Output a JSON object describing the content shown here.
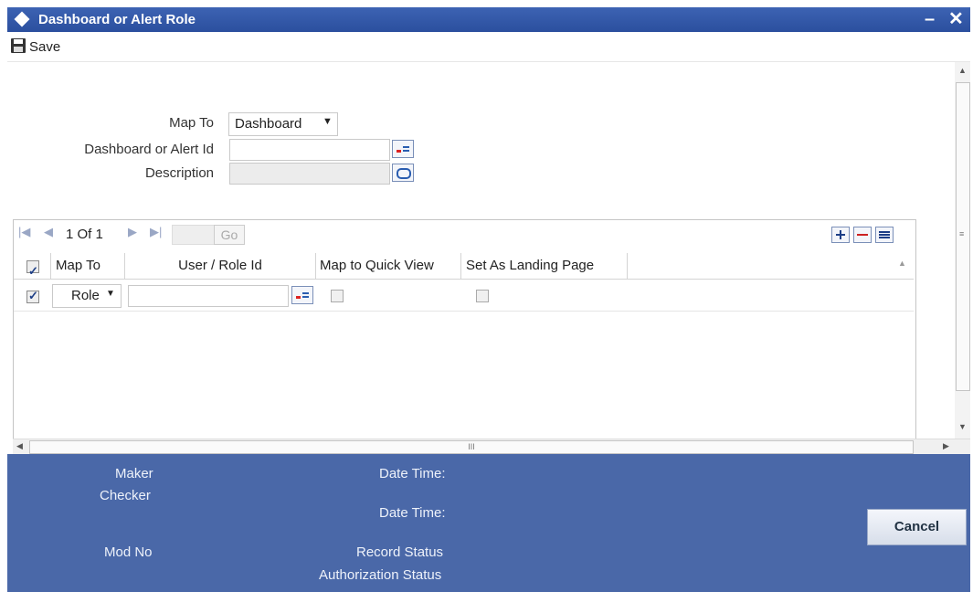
{
  "window": {
    "title": "Dashboard or Alert Role",
    "minimize_glyph": "–",
    "close_glyph": "✕"
  },
  "toolbar": {
    "save_label": "Save"
  },
  "form": {
    "map_to_label": "Map To",
    "map_to_value": "Dashboard",
    "alert_id_label": "Dashboard or Alert Id",
    "alert_id_value": "",
    "description_label": "Description",
    "description_value": ""
  },
  "pager": {
    "page_text": "1 Of 1",
    "go_label": "Go",
    "page_input_value": ""
  },
  "grid": {
    "columns": [
      "Map To",
      "User / Role Id",
      "Map to Quick View",
      "Set As Landing Page"
    ],
    "header_checked": true,
    "rows": [
      {
        "checked": true,
        "map_to": "Role",
        "user_role_id": "",
        "quick_view": false,
        "landing_page": false
      }
    ]
  },
  "scrollbar": {
    "h_thumb_glyph": "III"
  },
  "footer": {
    "maker_label": "Maker",
    "checker_label": "Checker",
    "date_time_label_1": "Date Time:",
    "date_time_label_2": "Date Time:",
    "mod_no_label": "Mod No",
    "record_status_label": "Record Status",
    "auth_status_label": "Authorization Status",
    "cancel_label": "Cancel"
  },
  "colors": {
    "title_bar": "#2b4f9e",
    "footer": "#4a68a8"
  }
}
